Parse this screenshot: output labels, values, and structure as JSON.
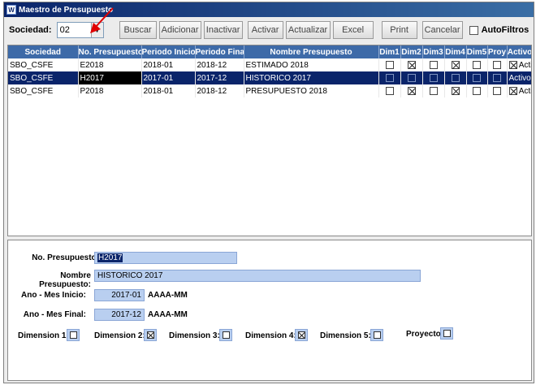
{
  "window": {
    "title": "Maestro de Presupuesto",
    "icon": "app-icon"
  },
  "toolbar": {
    "sociedad_label": "Sociedad:",
    "sociedad_value": "02",
    "buttons": [
      "Buscar",
      "Adicionar",
      "Inactivar",
      "Activar",
      "Actualizar",
      "Excel",
      "Print",
      "Cancelar"
    ],
    "autofiltros_label": "AutoFiltros"
  },
  "grid": {
    "columns": [
      "Sociedad",
      "No. Presupuesto",
      "Periodo Inicio",
      "Periodo Final",
      "Nombre Presupuesto",
      "Dim1",
      "Dim2",
      "Dim3",
      "Dim4",
      "Dim5",
      "Proy",
      "Activo"
    ],
    "rows": [
      {
        "sociedad": "SBO_CSFE",
        "no": "E2018",
        "inicio": "2018-01",
        "final": "2018-12",
        "nombre": "ESTIMADO 2018",
        "dims": [
          false,
          true,
          false,
          true,
          false,
          false
        ],
        "activo": "Activo",
        "selected": false
      },
      {
        "sociedad": "SBO_CSFE",
        "no": "H2017",
        "inicio": "2017-01",
        "final": "2017-12",
        "nombre": "HISTORICO 2017",
        "dims": [
          false,
          false,
          false,
          false,
          false,
          false
        ],
        "activo": "Activo",
        "selected": true
      },
      {
        "sociedad": "SBO_CSFE",
        "no": "P2018",
        "inicio": "2018-01",
        "final": "2018-12",
        "nombre": "PRESUPUESTO 2018",
        "dims": [
          false,
          true,
          false,
          true,
          false,
          false
        ],
        "activo": "Activo",
        "selected": false
      }
    ]
  },
  "form": {
    "no_label": "No. Presupuesto:",
    "no_value": "H2017",
    "nombre_label": "Nombre Presupuesto:",
    "nombre_value": "HISTORICO 2017",
    "inicio_label": "Ano - Mes Inicio:",
    "inicio_value": "2017-01",
    "inicio_fmt": "AAAA-MM",
    "final_label": "Ano - Mes Final:",
    "final_value": "2017-12",
    "final_fmt": "AAAA-MM",
    "dims": [
      {
        "label": "Dimension 1:",
        "checked": false
      },
      {
        "label": "Dimension 2:",
        "checked": true
      },
      {
        "label": "Dimension 3:",
        "checked": false
      },
      {
        "label": "Dimension 4:",
        "checked": true
      },
      {
        "label": "Dimension 5:",
        "checked": false
      },
      {
        "label": "Proyecto",
        "checked": false
      }
    ]
  },
  "colors": {
    "selected_row": "#0a246a",
    "header": "#3d6aa8",
    "field_bg": "#b9cff0",
    "annotation_arrow": "#e00000"
  }
}
